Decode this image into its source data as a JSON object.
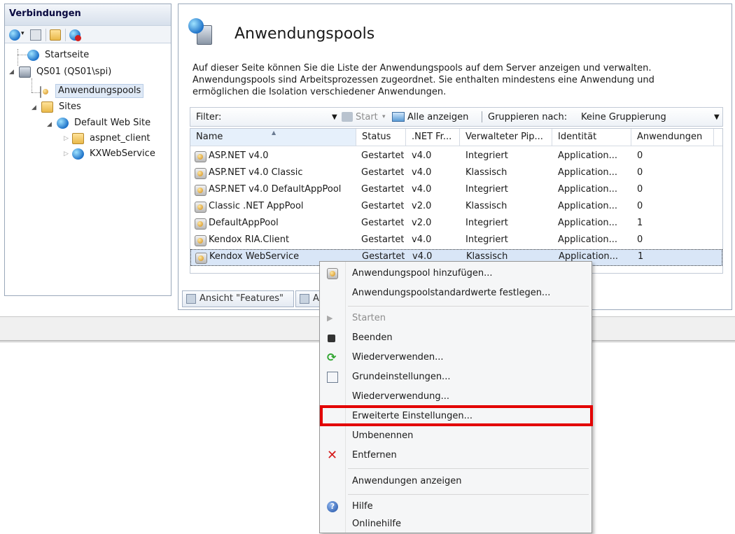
{
  "connections": {
    "title": "Verbindungen",
    "tree": [
      {
        "label": "Startseite"
      },
      {
        "label": "QS01 (QS01\\spi)"
      },
      {
        "label": "Anwendungspools"
      },
      {
        "label": "Sites"
      },
      {
        "label": "Default Web Site"
      },
      {
        "label": "aspnet_client"
      },
      {
        "label": "KXWebService"
      }
    ]
  },
  "main": {
    "heading": "Anwendungspools",
    "description": "Auf dieser Seite können Sie die Liste der Anwendungspools auf dem Server anzeigen und verwalten. Anwendungspools sind Arbeitsprozessen zugeordnet. Sie enthalten mindestens eine Anwendung und ermöglichen die Isolation verschiedener Anwendungen.",
    "filter": {
      "label": "Filter:",
      "start_label": "Start",
      "show_all_label": "Alle anzeigen",
      "group_by_label": "Gruppieren nach:",
      "group_by_value": "Keine Gruppierung"
    },
    "table": {
      "columns": [
        "Name",
        "Status",
        ".NET Fr...",
        "Verwalteter Pip...",
        "Identität",
        "Anwendungen"
      ],
      "rows": [
        [
          "ASP.NET v4.0",
          "Gestartet",
          "v4.0",
          "Integriert",
          "Application...",
          "0"
        ],
        [
          "ASP.NET v4.0 Classic",
          "Gestartet",
          "v4.0",
          "Klassisch",
          "Application...",
          "0"
        ],
        [
          "ASP.NET v4.0 DefaultAppPool",
          "Gestartet",
          "v4.0",
          "Integriert",
          "Application...",
          "0"
        ],
        [
          "Classic .NET AppPool",
          "Gestartet",
          "v2.0",
          "Klassisch",
          "Application...",
          "0"
        ],
        [
          "DefaultAppPool",
          "Gestartet",
          "v2.0",
          "Integriert",
          "Application...",
          "1"
        ],
        [
          "Kendox RIA.Client",
          "Gestartet",
          "v4.0",
          "Integriert",
          "Application...",
          "0"
        ],
        [
          "Kendox WebService",
          "Gestartet",
          "v4.0",
          "Klassisch",
          "Application...",
          "1"
        ]
      ]
    },
    "view_tabs": {
      "features": "Ansicht \"Features\"",
      "content": "A"
    }
  },
  "context_menu": {
    "items": [
      {
        "label": "Anwendungspool hinzufügen..."
      },
      {
        "label": "Anwendungspoolstandardwerte festlegen..."
      },
      {
        "label": "Starten"
      },
      {
        "label": "Beenden"
      },
      {
        "label": "Wiederverwenden..."
      },
      {
        "label": "Grundeinstellungen..."
      },
      {
        "label": "Wiederverwendung..."
      },
      {
        "label": "Erweiterte Einstellungen..."
      },
      {
        "label": "Umbenennen"
      },
      {
        "label": "Entfernen"
      },
      {
        "label": "Anwendungen anzeigen"
      },
      {
        "label": "Hilfe"
      },
      {
        "label": "Onlinehilfe"
      }
    ],
    "highlight_color": "#e30000"
  },
  "colors": {
    "selection": "#d9e6f7",
    "pane_border": "#9aa8ba"
  }
}
